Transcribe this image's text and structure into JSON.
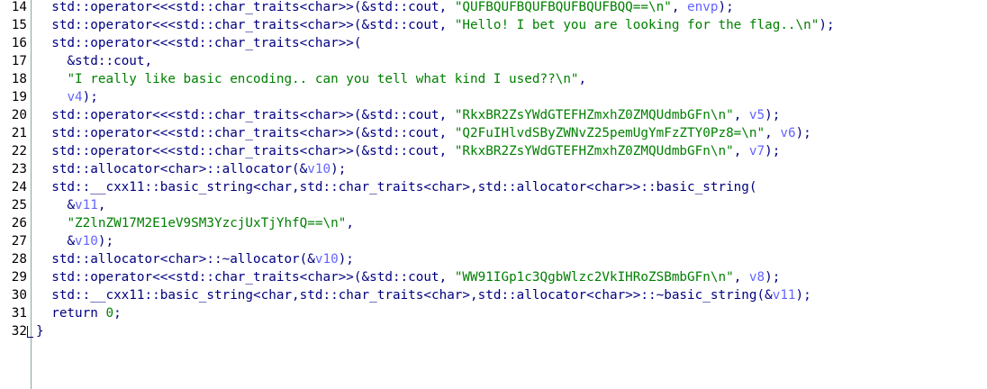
{
  "editor": {
    "lines": [
      {
        "num": "14",
        "indent": "  ",
        "tokens": [
          {
            "t": "std::operator<<<std::char_traits<char>>(&std::cout, ",
            "c": "def"
          },
          {
            "t": "\"QUFBQUFBQUFBQUFBQUFBQQ==\\n\"",
            "c": "str"
          },
          {
            "t": ", ",
            "c": "def"
          },
          {
            "t": "envp",
            "c": "var"
          },
          {
            "t": ");",
            "c": "def"
          }
        ]
      },
      {
        "num": "15",
        "indent": "  ",
        "tokens": [
          {
            "t": "std::operator<<<std::char_traits<char>>(&std::cout, ",
            "c": "def"
          },
          {
            "t": "\"Hello! I bet you are looking for the flag..\\n\"",
            "c": "str"
          },
          {
            "t": ");",
            "c": "def"
          }
        ]
      },
      {
        "num": "16",
        "indent": "  ",
        "tokens": [
          {
            "t": "std::operator<<<std::char_traits<char>>(",
            "c": "def"
          }
        ]
      },
      {
        "num": "17",
        "indent": "    ",
        "tokens": [
          {
            "t": "&std::cout,",
            "c": "def"
          }
        ]
      },
      {
        "num": "18",
        "indent": "    ",
        "tokens": [
          {
            "t": "\"I really like basic encoding.. can you tell what kind I used??\\n\"",
            "c": "str"
          },
          {
            "t": ",",
            "c": "def"
          }
        ]
      },
      {
        "num": "19",
        "indent": "    ",
        "tokens": [
          {
            "t": "v4",
            "c": "var"
          },
          {
            "t": ");",
            "c": "def"
          }
        ]
      },
      {
        "num": "20",
        "indent": "  ",
        "tokens": [
          {
            "t": "std::operator<<<std::char_traits<char>>(&std::cout, ",
            "c": "def"
          },
          {
            "t": "\"RkxBR2ZsYWdGTEFHZmxhZ0ZMQUdmbGFn\\n\"",
            "c": "str"
          },
          {
            "t": ", ",
            "c": "def"
          },
          {
            "t": "v5",
            "c": "var"
          },
          {
            "t": ");",
            "c": "def"
          }
        ]
      },
      {
        "num": "21",
        "indent": "  ",
        "tokens": [
          {
            "t": "std::operator<<<std::char_traits<char>>(&std::cout, ",
            "c": "def"
          },
          {
            "t": "\"Q2FuIHlvdSByZWNvZ25pemUgYmFzZTY0Pz8=\\n\"",
            "c": "str"
          },
          {
            "t": ", ",
            "c": "def"
          },
          {
            "t": "v6",
            "c": "var"
          },
          {
            "t": ");",
            "c": "def"
          }
        ]
      },
      {
        "num": "22",
        "indent": "  ",
        "tokens": [
          {
            "t": "std::operator<<<std::char_traits<char>>(&std::cout, ",
            "c": "def"
          },
          {
            "t": "\"RkxBR2ZsYWdGTEFHZmxhZ0ZMQUdmbGFn\\n\"",
            "c": "str"
          },
          {
            "t": ", ",
            "c": "def"
          },
          {
            "t": "v7",
            "c": "var"
          },
          {
            "t": ");",
            "c": "def"
          }
        ]
      },
      {
        "num": "23",
        "indent": "  ",
        "tokens": [
          {
            "t": "std::allocator<char>::allocator(&",
            "c": "def"
          },
          {
            "t": "v10",
            "c": "var"
          },
          {
            "t": ");",
            "c": "def"
          }
        ]
      },
      {
        "num": "24",
        "indent": "  ",
        "tokens": [
          {
            "t": "std::__cxx11::basic_string<char,std::char_traits<char>,std::allocator<char>>::basic_string(",
            "c": "def"
          }
        ]
      },
      {
        "num": "25",
        "indent": "    ",
        "tokens": [
          {
            "t": "&",
            "c": "def"
          },
          {
            "t": "v11",
            "c": "var"
          },
          {
            "t": ",",
            "c": "def"
          }
        ]
      },
      {
        "num": "26",
        "indent": "    ",
        "tokens": [
          {
            "t": "\"Z2lnZW17M2E1eV9SM3YzcjUxTjYhfQ==\\n\"",
            "c": "str"
          },
          {
            "t": ",",
            "c": "def"
          }
        ]
      },
      {
        "num": "27",
        "indent": "    ",
        "tokens": [
          {
            "t": "&",
            "c": "def"
          },
          {
            "t": "v10",
            "c": "var"
          },
          {
            "t": ");",
            "c": "def"
          }
        ]
      },
      {
        "num": "28",
        "indent": "  ",
        "tokens": [
          {
            "t": "std::allocator<char>::~allocator(&",
            "c": "def"
          },
          {
            "t": "v10",
            "c": "var"
          },
          {
            "t": ");",
            "c": "def"
          }
        ]
      },
      {
        "num": "29",
        "indent": "  ",
        "tokens": [
          {
            "t": "std::operator<<<std::char_traits<char>>(&std::cout, ",
            "c": "def"
          },
          {
            "t": "\"WW91IGp1c3QgbWlzc2VkIHRoZSBmbGFn\\n\"",
            "c": "str"
          },
          {
            "t": ", ",
            "c": "def"
          },
          {
            "t": "v8",
            "c": "var"
          },
          {
            "t": ");",
            "c": "def"
          }
        ]
      },
      {
        "num": "30",
        "indent": "  ",
        "tokens": [
          {
            "t": "std::__cxx11::basic_string<char,std::char_traits<char>,std::allocator<char>>::~basic_string(&",
            "c": "def"
          },
          {
            "t": "v11",
            "c": "var"
          },
          {
            "t": ");",
            "c": "def"
          }
        ]
      },
      {
        "num": "31",
        "indent": "  ",
        "tokens": [
          {
            "t": "return ",
            "c": "def"
          },
          {
            "t": "0",
            "c": "num"
          },
          {
            "t": ";",
            "c": "def"
          }
        ]
      },
      {
        "num": "32",
        "indent": "",
        "tokens": [
          {
            "t": "}",
            "c": "def"
          }
        ]
      }
    ]
  },
  "colors": {
    "default": "#000080",
    "string": "#008000",
    "variable": "#6464ff",
    "line_number": "#000000",
    "gutter_border": "#8aa6a0"
  }
}
